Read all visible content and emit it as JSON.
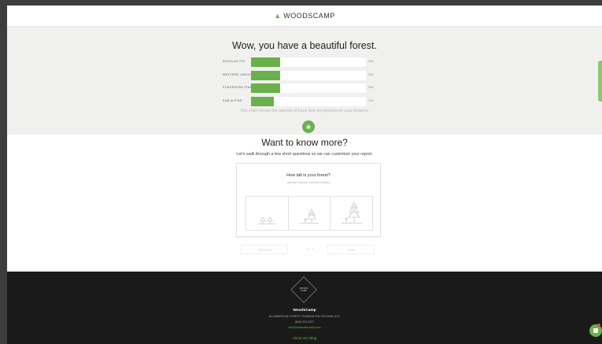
{
  "header": {
    "brand": "WOODSCAMP",
    "brand_icon": "tree-icon"
  },
  "summary": {
    "title": "Wow, you have a beautiful forest.",
    "bars": [
      {
        "label": "DOUGLAS FIR",
        "percent": 25,
        "value_text": "25%"
      },
      {
        "label": "WESTERN LARCH",
        "percent": 25,
        "value_text": "25%"
      },
      {
        "label": "PONDEROSA PINE",
        "percent": 25,
        "value_text": "25%"
      },
      {
        "label": "SUB ALPINE",
        "percent": 20,
        "value_text": "20%"
      }
    ],
    "caption": "This chart shows the species of trees that are growing on your property."
  },
  "intro": {
    "title": "Want to know more?",
    "subtitle": "Let's walk through a few short questions so we can customize your report."
  },
  "question": {
    "text": "How tall is your forest?",
    "hint": "(please choose a picture below)",
    "options": [
      {
        "icon": "short-trees-icon"
      },
      {
        "icon": "medium-trees-icon"
      },
      {
        "icon": "tall-trees-icon"
      }
    ]
  },
  "nav": {
    "previous": "Previous",
    "pager": "1 / 7",
    "next": "Next"
  },
  "footer": {
    "logo_line1": "WOODS",
    "logo_line2": "CAMP",
    "name": "WoodsCamp",
    "tagline": "AN AMERICAN FOREST FOUNDATION TECHNOLOGY",
    "phone": "(844) 922-3227",
    "email": "info@mywoodscamp.com",
    "links": "About Us | Blog"
  },
  "colors": {
    "accent": "#6ab04c",
    "footer_bg": "#1a1a1a",
    "panel_bg": "#f0f0ef"
  }
}
